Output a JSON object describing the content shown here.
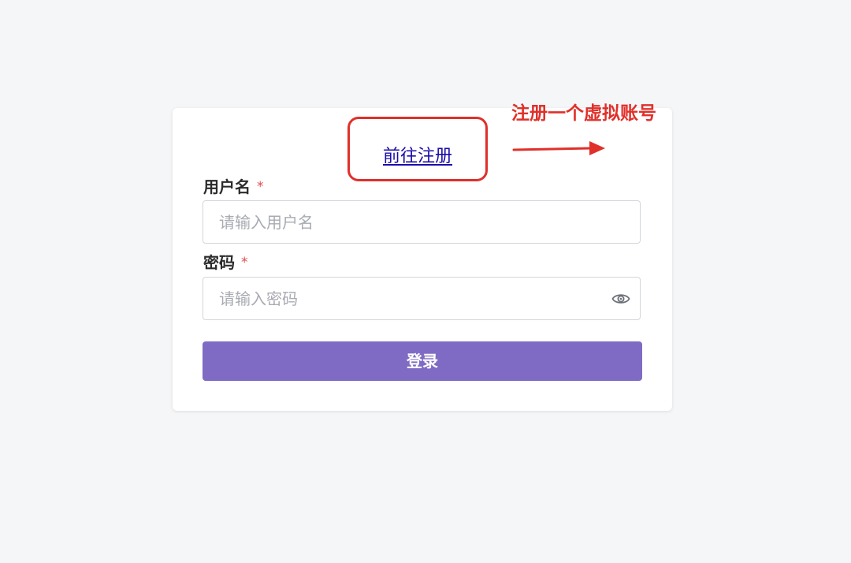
{
  "login": {
    "register_link": "前往注册",
    "username": {
      "label": "用户名",
      "required_mark": "*",
      "placeholder": "请输入用户名",
      "value": ""
    },
    "password": {
      "label": "密码",
      "required_mark": "*",
      "placeholder": "请输入密码",
      "value": "",
      "toggle_icon": "eye-icon"
    },
    "submit_label": "登录"
  },
  "annotation": {
    "text": "注册一个虚拟账号",
    "color": "#e0302a"
  },
  "colors": {
    "accent": "#806bc4",
    "required": "#e5484d",
    "link": "#1a0dab",
    "background": "#f5f6f8"
  }
}
